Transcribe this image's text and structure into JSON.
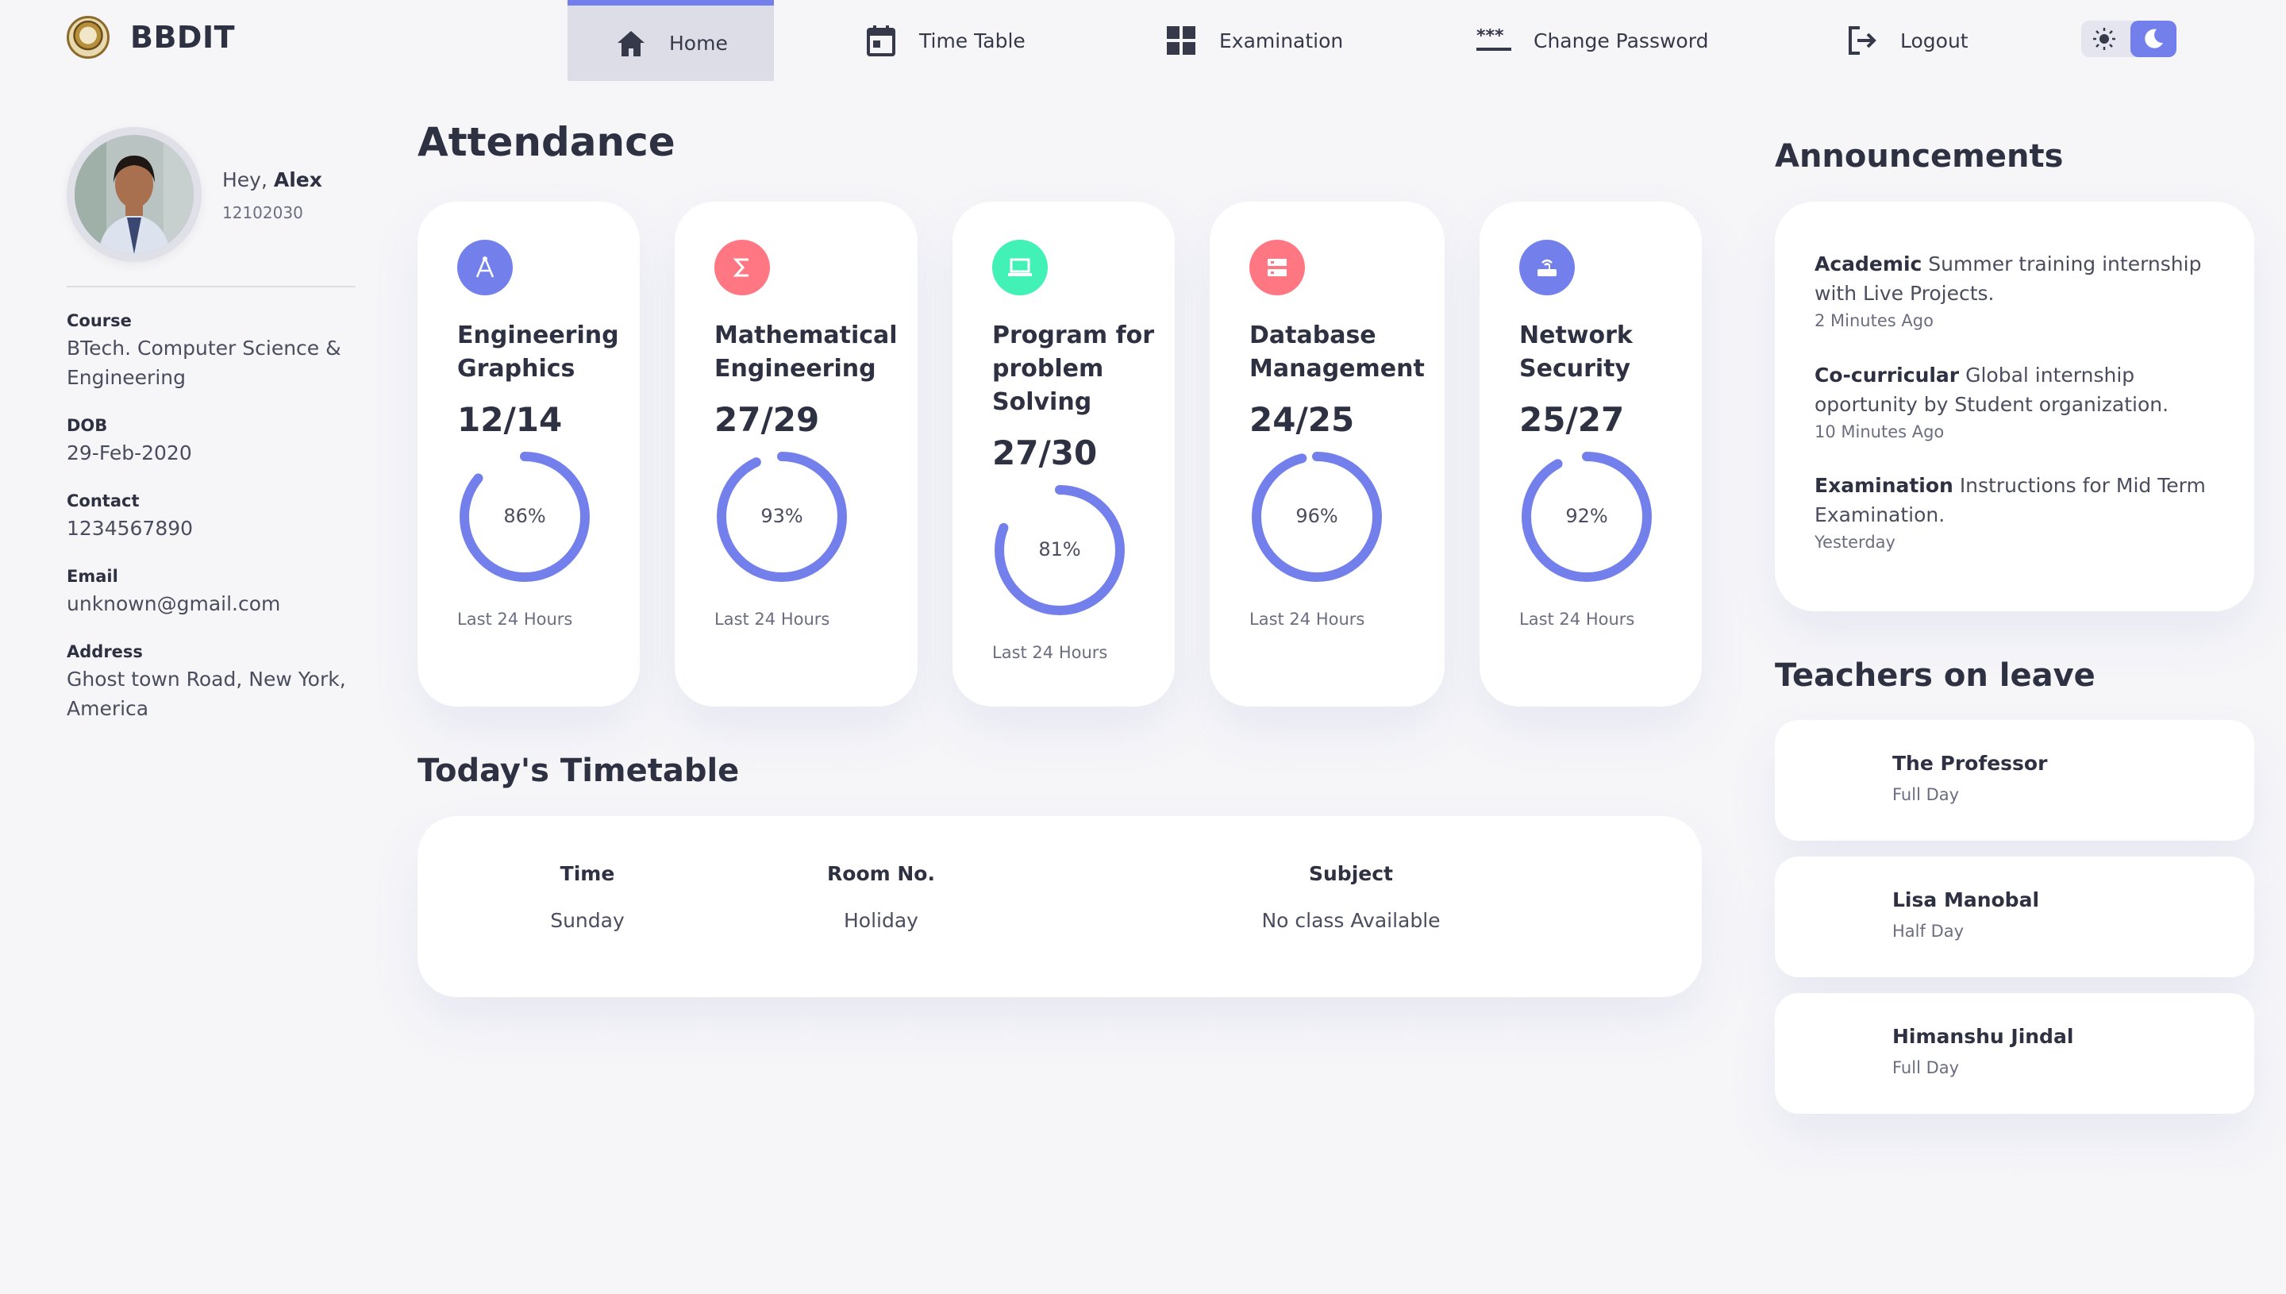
{
  "header": {
    "brand": "BBDIT",
    "nav": [
      {
        "label": "Home",
        "icon": "home-icon",
        "active": true
      },
      {
        "label": "Time Table",
        "icon": "calendar-icon",
        "active": false
      },
      {
        "label": "Examination",
        "icon": "grid-icon",
        "active": false
      },
      {
        "label": "Change Password",
        "icon": "password-icon",
        "active": false
      },
      {
        "label": "Logout",
        "icon": "logout-icon",
        "active": false
      }
    ],
    "theme": {
      "light_icon": "sun-icon",
      "dark_icon": "moon-icon",
      "selected": "dark"
    }
  },
  "profile": {
    "greeting": "Hey,",
    "name": "Alex",
    "roll_no": "12102030",
    "fields": [
      {
        "label": "Course",
        "value": "BTech. Computer Science & Engineering"
      },
      {
        "label": "DOB",
        "value": "29-Feb-2020"
      },
      {
        "label": "Contact",
        "value": "1234567890"
      },
      {
        "label": "Email",
        "value": "unknown@gmail.com"
      },
      {
        "label": "Address",
        "value": "Ghost town Road, New York, America"
      }
    ]
  },
  "attendance": {
    "title": "Attendance",
    "cards": [
      {
        "subject": "Engineering Graphics",
        "ratio": "12/14",
        "percent_label": "86%",
        "percent": 86,
        "footer": "Last 24 Hours",
        "icon": "compass-icon",
        "icon_color": "#7380ec"
      },
      {
        "subject": "Mathematical Engineering",
        "ratio": "27/29",
        "percent_label": "93%",
        "percent": 93,
        "footer": "Last 24 Hours",
        "icon": "sigma-icon",
        "icon_color": "#ff7782"
      },
      {
        "subject": "Program for problem Solving",
        "ratio": "27/30",
        "percent_label": "81%",
        "percent": 81,
        "footer": "Last 24 Hours",
        "icon": "laptop-icon",
        "icon_color": "#41f1b6"
      },
      {
        "subject": "Database Management",
        "ratio": "24/25",
        "percent_label": "96%",
        "percent": 96,
        "footer": "Last 24 Hours",
        "icon": "database-icon",
        "icon_color": "#ff7782"
      },
      {
        "subject": "Network Security",
        "ratio": "25/27",
        "percent_label": "92%",
        "percent": 92,
        "footer": "Last 24 Hours",
        "icon": "router-icon",
        "icon_color": "#7380ec"
      }
    ],
    "ring_color": "#7380ec"
  },
  "timetable": {
    "title": "Today's Timetable",
    "headers": [
      "Time",
      "Room No.",
      "Subject"
    ],
    "rows": [
      [
        "Sunday",
        "Holiday",
        "No class Available"
      ]
    ]
  },
  "announcements": {
    "title": "Announcements",
    "items": [
      {
        "category": "Academic",
        "text": "Summer training internship with Live Projects.",
        "time": "2 Minutes Ago"
      },
      {
        "category": "Co-curricular",
        "text": "Global internship oportunity by Student organization.",
        "time": "10 Minutes Ago"
      },
      {
        "category": "Examination",
        "text": "Instructions for Mid Term Examination.",
        "time": "Yesterday"
      }
    ]
  },
  "teachers_on_leave": {
    "title": "Teachers on leave",
    "items": [
      {
        "name": "The Professor",
        "type": "Full Day"
      },
      {
        "name": "Lisa Manobal",
        "type": "Half Day"
      },
      {
        "name": "Himanshu Jindal",
        "type": "Full Day"
      }
    ]
  }
}
